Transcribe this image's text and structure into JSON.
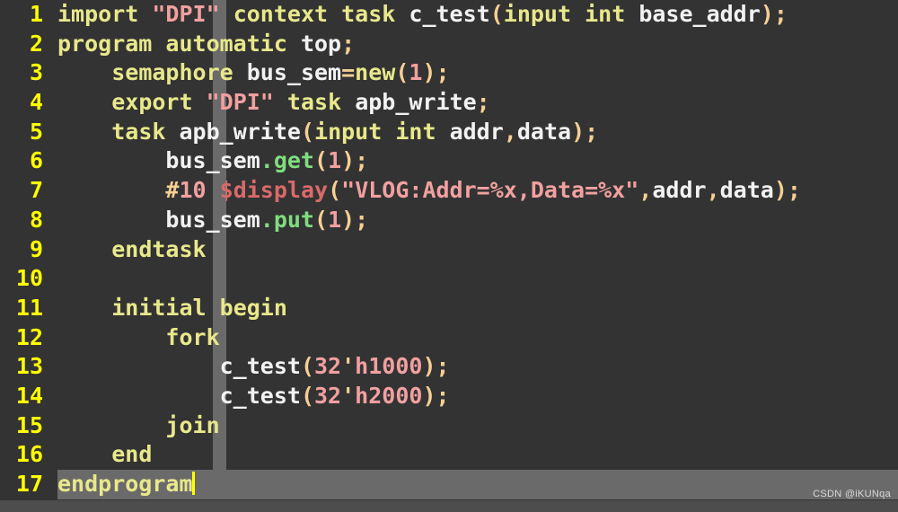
{
  "editor": {
    "language": "SystemVerilog",
    "theme": {
      "background": "#333333",
      "gutter_text": "#ffff00",
      "keyword": "#e8e88c",
      "identifier": "#f2f2f2",
      "string": "#f2a0a0",
      "number": "#f2a0a0",
      "punctuation": "#f5cf94",
      "method": "#7fdd7f",
      "system_function": "#d96a6a",
      "current_line_highlight": "#6a6a6a",
      "column_guide": "#6a6a6a",
      "caret": "#ffff00",
      "bottom_strip": "#4d4d4d"
    },
    "total_lines": 17,
    "current_line": 17,
    "cursor_column": 12
  },
  "watermark": {
    "text": "CSDN @iKUNqa"
  },
  "lines": [
    {
      "number": "1",
      "current": false,
      "tokens": [
        {
          "t": "import",
          "c": "kw"
        },
        {
          "t": " ",
          "c": "plain"
        },
        {
          "t": "\"DPI\"",
          "c": "str"
        },
        {
          "t": " ",
          "c": "plain"
        },
        {
          "t": "context",
          "c": "kw"
        },
        {
          "t": " ",
          "c": "plain"
        },
        {
          "t": "task",
          "c": "kw"
        },
        {
          "t": " ",
          "c": "plain"
        },
        {
          "t": "c_test",
          "c": "plain"
        },
        {
          "t": "(",
          "c": "punc"
        },
        {
          "t": "input",
          "c": "kw"
        },
        {
          "t": " ",
          "c": "plain"
        },
        {
          "t": "int",
          "c": "kw"
        },
        {
          "t": " ",
          "c": "plain"
        },
        {
          "t": "base_addr",
          "c": "plain"
        },
        {
          "t": ");",
          "c": "punc"
        }
      ]
    },
    {
      "number": "2",
      "current": false,
      "tokens": [
        {
          "t": "program",
          "c": "kw"
        },
        {
          "t": " ",
          "c": "plain"
        },
        {
          "t": "automatic",
          "c": "kw"
        },
        {
          "t": " ",
          "c": "plain"
        },
        {
          "t": "top",
          "c": "plain"
        },
        {
          "t": ";",
          "c": "punc"
        }
      ]
    },
    {
      "number": "3",
      "current": false,
      "tokens": [
        {
          "t": "    ",
          "c": "plain"
        },
        {
          "t": "semaphore",
          "c": "kw"
        },
        {
          "t": " ",
          "c": "plain"
        },
        {
          "t": "bus_sem",
          "c": "plain"
        },
        {
          "t": "=",
          "c": "punc"
        },
        {
          "t": "new",
          "c": "kw"
        },
        {
          "t": "(",
          "c": "punc"
        },
        {
          "t": "1",
          "c": "num"
        },
        {
          "t": ");",
          "c": "punc"
        }
      ]
    },
    {
      "number": "4",
      "current": false,
      "tokens": [
        {
          "t": "    ",
          "c": "plain"
        },
        {
          "t": "export",
          "c": "kw"
        },
        {
          "t": " ",
          "c": "plain"
        },
        {
          "t": "\"DPI\"",
          "c": "str"
        },
        {
          "t": " ",
          "c": "plain"
        },
        {
          "t": "task",
          "c": "kw"
        },
        {
          "t": " ",
          "c": "plain"
        },
        {
          "t": "apb_write",
          "c": "plain"
        },
        {
          "t": ";",
          "c": "punc"
        }
      ]
    },
    {
      "number": "5",
      "current": false,
      "tokens": [
        {
          "t": "    ",
          "c": "plain"
        },
        {
          "t": "task",
          "c": "kw"
        },
        {
          "t": " ",
          "c": "plain"
        },
        {
          "t": "apb_write",
          "c": "plain"
        },
        {
          "t": "(",
          "c": "punc"
        },
        {
          "t": "input",
          "c": "kw"
        },
        {
          "t": " ",
          "c": "plain"
        },
        {
          "t": "int",
          "c": "kw"
        },
        {
          "t": " ",
          "c": "plain"
        },
        {
          "t": "addr",
          "c": "plain"
        },
        {
          "t": ",",
          "c": "punc"
        },
        {
          "t": "data",
          "c": "plain"
        },
        {
          "t": ");",
          "c": "punc"
        }
      ]
    },
    {
      "number": "6",
      "current": false,
      "tokens": [
        {
          "t": "        ",
          "c": "plain"
        },
        {
          "t": "bus_sem",
          "c": "plain"
        },
        {
          "t": ".get",
          "c": "meth"
        },
        {
          "t": "(",
          "c": "punc"
        },
        {
          "t": "1",
          "c": "num"
        },
        {
          "t": ");",
          "c": "punc"
        }
      ]
    },
    {
      "number": "7",
      "current": false,
      "tokens": [
        {
          "t": "        ",
          "c": "plain"
        },
        {
          "t": "#",
          "c": "punc"
        },
        {
          "t": "10",
          "c": "num"
        },
        {
          "t": " ",
          "c": "plain"
        },
        {
          "t": "$display",
          "c": "sysfn"
        },
        {
          "t": "(",
          "c": "punc"
        },
        {
          "t": "\"VLOG:Addr=%x,Data=%x\"",
          "c": "str"
        },
        {
          "t": ",",
          "c": "punc"
        },
        {
          "t": "addr",
          "c": "plain"
        },
        {
          "t": ",",
          "c": "punc"
        },
        {
          "t": "data",
          "c": "plain"
        },
        {
          "t": ");",
          "c": "punc"
        }
      ]
    },
    {
      "number": "8",
      "current": false,
      "tokens": [
        {
          "t": "        ",
          "c": "plain"
        },
        {
          "t": "bus_sem",
          "c": "plain"
        },
        {
          "t": ".put",
          "c": "meth"
        },
        {
          "t": "(",
          "c": "punc"
        },
        {
          "t": "1",
          "c": "num"
        },
        {
          "t": ");",
          "c": "punc"
        }
      ]
    },
    {
      "number": "9",
      "current": false,
      "tokens": [
        {
          "t": "    ",
          "c": "plain"
        },
        {
          "t": "endtask",
          "c": "kw"
        }
      ]
    },
    {
      "number": "10",
      "current": false,
      "tokens": []
    },
    {
      "number": "11",
      "current": false,
      "tokens": [
        {
          "t": "    ",
          "c": "plain"
        },
        {
          "t": "initial",
          "c": "kw"
        },
        {
          "t": " ",
          "c": "plain"
        },
        {
          "t": "begin",
          "c": "kw"
        }
      ]
    },
    {
      "number": "12",
      "current": false,
      "tokens": [
        {
          "t": "        ",
          "c": "plain"
        },
        {
          "t": "fork",
          "c": "kw"
        }
      ]
    },
    {
      "number": "13",
      "current": false,
      "tokens": [
        {
          "t": "            ",
          "c": "plain"
        },
        {
          "t": "c_test",
          "c": "plain"
        },
        {
          "t": "(",
          "c": "punc"
        },
        {
          "t": "32",
          "c": "num"
        },
        {
          "t": "'",
          "c": "punc"
        },
        {
          "t": "h1000",
          "c": "num"
        },
        {
          "t": ");",
          "c": "punc"
        }
      ]
    },
    {
      "number": "14",
      "current": false,
      "tokens": [
        {
          "t": "            ",
          "c": "plain"
        },
        {
          "t": "c_test",
          "c": "plain"
        },
        {
          "t": "(",
          "c": "punc"
        },
        {
          "t": "32",
          "c": "num"
        },
        {
          "t": "'",
          "c": "punc"
        },
        {
          "t": "h2000",
          "c": "num"
        },
        {
          "t": ");",
          "c": "punc"
        }
      ]
    },
    {
      "number": "15",
      "current": false,
      "tokens": [
        {
          "t": "        ",
          "c": "plain"
        },
        {
          "t": "join",
          "c": "kw"
        }
      ]
    },
    {
      "number": "16",
      "current": false,
      "tokens": [
        {
          "t": "    ",
          "c": "plain"
        },
        {
          "t": "end",
          "c": "kw"
        }
      ]
    },
    {
      "number": "17",
      "current": true,
      "caret": true,
      "tokens": [
        {
          "t": "endprogram",
          "c": "kw"
        }
      ]
    }
  ]
}
